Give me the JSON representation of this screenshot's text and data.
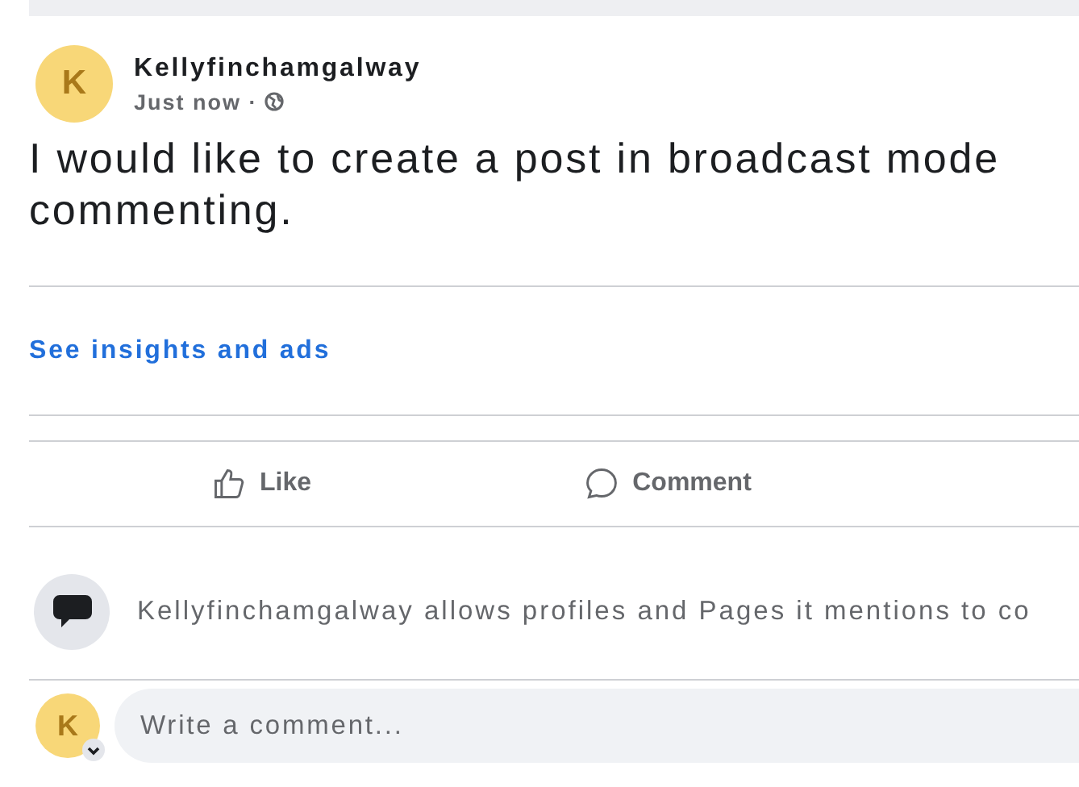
{
  "post": {
    "author": "Kellyfinchamgalway",
    "avatar_letter": "K",
    "time": "Just now ·",
    "text_lines": [
      "I would like to create a post in broadcast mode",
      "commenting."
    ],
    "insights_link": "See insights and ads"
  },
  "actions": [
    {
      "label": "Like",
      "kind": "like"
    },
    {
      "label": "Comment",
      "kind": "comment"
    }
  ],
  "notice": "Kellyfinchamgalway allows profiles and Pages it mentions to co",
  "comment_box": {
    "avatar_letter": "K",
    "placeholder": "Write a comment..."
  }
}
